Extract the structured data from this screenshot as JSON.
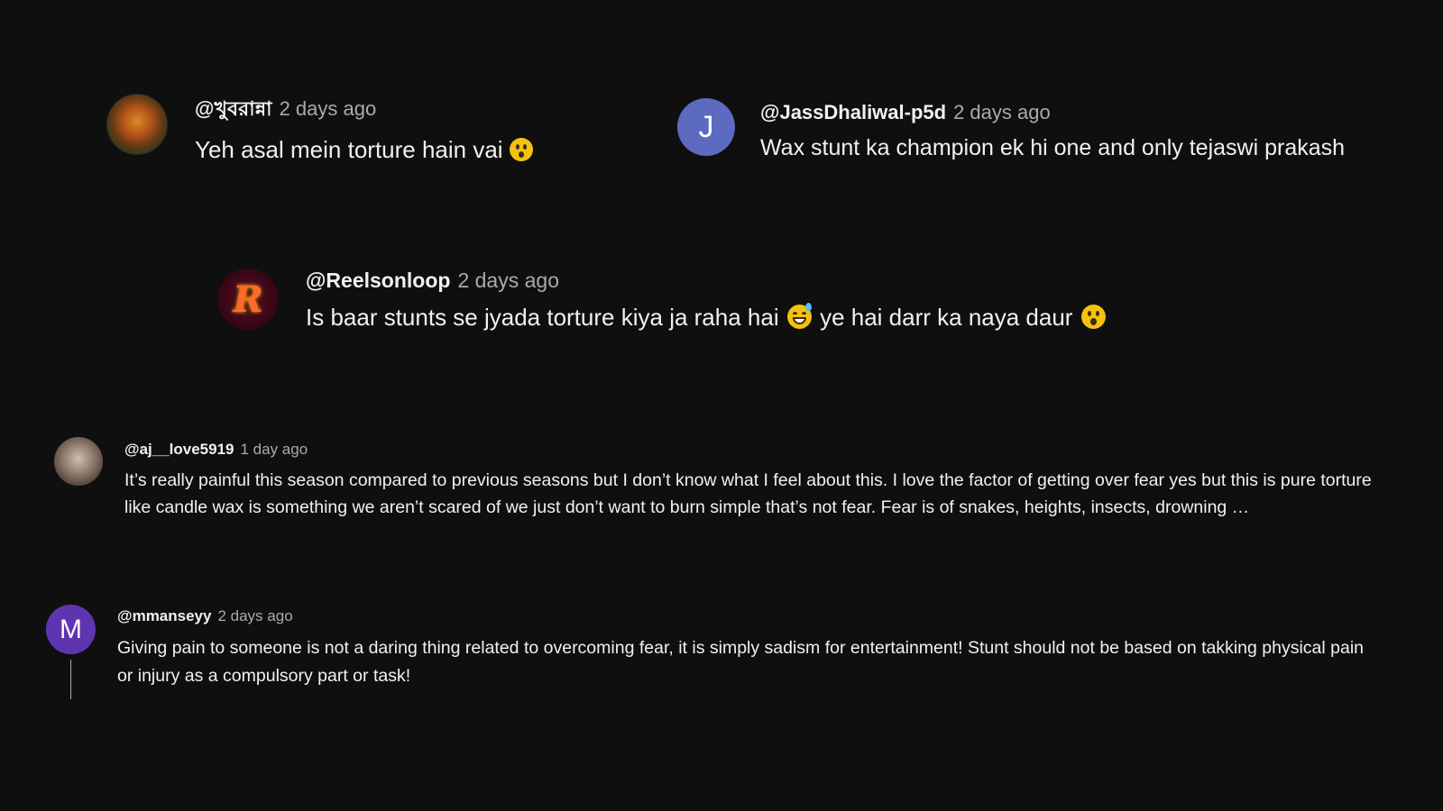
{
  "comments": [
    {
      "author": "@খুবরান্না",
      "time": "2 days ago",
      "text": "Yeh asal mein torture hain vai ",
      "emoji": "hushed-face"
    },
    {
      "author": "@JassDhaliwal-p5d",
      "time": "2 days ago",
      "avatar_letter": "J",
      "avatar_color": "#5c6bc0",
      "text": "Wax stunt ka champion ek hi one and only tejaswi prakash"
    },
    {
      "author": "@Reelsonloop",
      "time": "2 days ago",
      "avatar_letter": "R",
      "text_a": "Is baar stunts se jyada torture kiya ja raha hai",
      "emoji_a": "grinning-sweat-face",
      "text_b": "ye hai darr ka naya daur",
      "emoji_b": "hushed-face"
    },
    {
      "author": "@aj__love5919",
      "time": "1 day ago",
      "text": "It’s really painful this season compared to previous seasons but I don’t know what I feel about this. I love the factor of getting over fear yes but this is pure torture like candle wax is something we aren’t scared of we just don’t  want to burn simple that’s not fear. Fear is of snakes, heights, insects, drowning …"
    },
    {
      "author": "@mmanseyy",
      "time": "2 days ago",
      "avatar_letter": "M",
      "avatar_color": "#5e35b1",
      "text": "Giving pain to someone is not a daring thing related to overcoming fear, it is simply sadism for entertainment! Stunt should not be based on takking physical pain or injury as a compulsory part or task!"
    }
  ],
  "colors": {
    "background": "#0f0f0f",
    "primary_text": "#f1f1f1",
    "secondary_text": "#aaaaaa",
    "emoji_yellow": "#f4c20d"
  }
}
